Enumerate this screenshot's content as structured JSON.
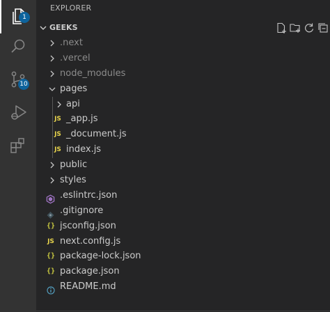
{
  "activity_bar": {
    "explorer_badge": "1",
    "source_control_badge": "10"
  },
  "sidebar": {
    "title": "EXPLORER",
    "section_title": "GEEKS"
  },
  "tree": [
    {
      "label": ".next",
      "kind": "folder",
      "state": "collapsed",
      "dim": true
    },
    {
      "label": ".vercel",
      "kind": "folder",
      "state": "collapsed",
      "dim": true
    },
    {
      "label": "node_modules",
      "kind": "folder",
      "state": "collapsed",
      "dim": true
    },
    {
      "label": "pages",
      "kind": "folder",
      "state": "expanded",
      "dim": false
    },
    {
      "label": "api",
      "kind": "folder",
      "state": "collapsed",
      "dim": false,
      "depth": 1
    },
    {
      "label": "_app.js",
      "kind": "file",
      "icon": "JS",
      "depth": 1
    },
    {
      "label": "_document.js",
      "kind": "file",
      "icon": "JS",
      "depth": 1
    },
    {
      "label": "index.js",
      "kind": "file",
      "icon": "JS",
      "depth": 1
    },
    {
      "label": "public",
      "kind": "folder",
      "state": "collapsed"
    },
    {
      "label": "styles",
      "kind": "folder",
      "state": "collapsed"
    },
    {
      "label": ".eslintrc.json",
      "kind": "file",
      "icon": "eslint"
    },
    {
      "label": ".gitignore",
      "kind": "file",
      "icon": "git"
    },
    {
      "label": "jsconfig.json",
      "kind": "file",
      "icon": "{}"
    },
    {
      "label": "next.config.js",
      "kind": "file",
      "icon": "JS"
    },
    {
      "label": "package-lock.json",
      "kind": "file",
      "icon": "{}"
    },
    {
      "label": "package.json",
      "kind": "file",
      "icon": "{}"
    },
    {
      "label": "README.md",
      "kind": "file",
      "icon": "info"
    }
  ],
  "icon_labels": {
    "js": "JS",
    "json": "{}"
  },
  "colors": {
    "activity_bar": "#333333",
    "sidebar": "#252526",
    "badge": "#0e639c",
    "js_icon": "#e8d44d",
    "json_icon": "#cbcb41",
    "eslint_icon": "#a074c4",
    "info_icon": "#519aba"
  }
}
